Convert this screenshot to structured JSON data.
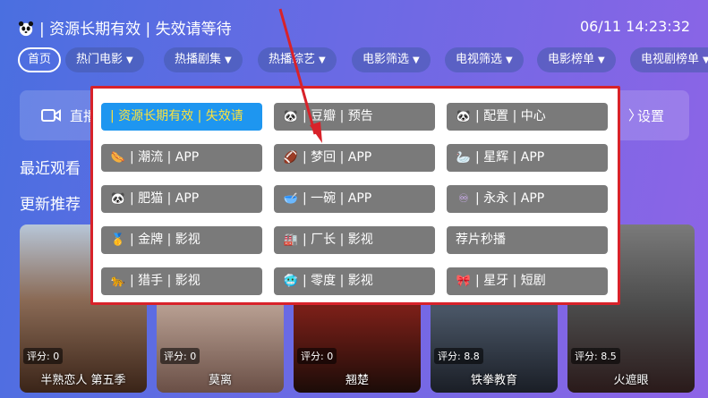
{
  "header": {
    "title": "| 资源长期有效 | 失效请等待",
    "time": "06/11 14:23:32"
  },
  "nav": {
    "tabs": [
      {
        "label": "首页",
        "has_arrow": false,
        "active": true
      },
      {
        "label": "热门电影",
        "has_arrow": true
      },
      {
        "label": "热播剧集",
        "has_arrow": true
      },
      {
        "label": "热播综艺",
        "has_arrow": true
      },
      {
        "label": "电影筛选",
        "has_arrow": true
      },
      {
        "label": "电视筛选",
        "has_arrow": true
      },
      {
        "label": "电影榜单",
        "has_arrow": true
      },
      {
        "label": "电视剧榜单",
        "has_arrow": true
      }
    ],
    "arrow_glyph": "▼"
  },
  "background": {
    "live_label": "直播",
    "settings_label": "设置",
    "recent_title": "最近观看",
    "updates_title": "更新推荐"
  },
  "posters": [
    {
      "name": "半熟恋人 第五季",
      "rating": "评分: 0"
    },
    {
      "name": "莫离",
      "rating": "评分: 0"
    },
    {
      "name": "翘楚",
      "rating": "评分: 0"
    },
    {
      "name": "铁拳教育",
      "rating": "评分: 8.8"
    },
    {
      "name": "火遮眼",
      "rating": "评分: 8.5"
    }
  ],
  "menu": {
    "buttons": [
      {
        "label": "| 资源长期有效 | 失效请",
        "icon": "",
        "active": true
      },
      {
        "label": "| 豆瓣 | 预告",
        "icon": "🐼"
      },
      {
        "label": "| 配置 | 中心",
        "icon": "🐼"
      },
      {
        "label": "| 潮流 | APP",
        "icon": "🌭"
      },
      {
        "label": "| 梦回 | APP",
        "icon": "🏈"
      },
      {
        "label": "| 星辉 | APP",
        "icon": "🦢"
      },
      {
        "label": "| 肥猫 | APP",
        "icon": "🐼"
      },
      {
        "label": "| 一碗 | APP",
        "icon": "🥣"
      },
      {
        "label": "| 永永 | APP",
        "icon": "♾"
      },
      {
        "label": "| 金牌 | 影视",
        "icon": "🥇"
      },
      {
        "label": "| 厂长 | 影视",
        "icon": "🏭"
      },
      {
        "label": "荐片秒播",
        "icon": ""
      },
      {
        "label": "| 猎手 | 影视",
        "icon": "🐆"
      },
      {
        "label": "| 零度 | 影视",
        "icon": "🥶"
      },
      {
        "label": "| 星牙 | 短剧",
        "icon": "🎀"
      }
    ]
  },
  "colors": {
    "accent_active": "#1e96f0",
    "active_text": "#ffe23a",
    "button_bg": "#7a7a7a",
    "highlight_border": "#d8222a"
  }
}
